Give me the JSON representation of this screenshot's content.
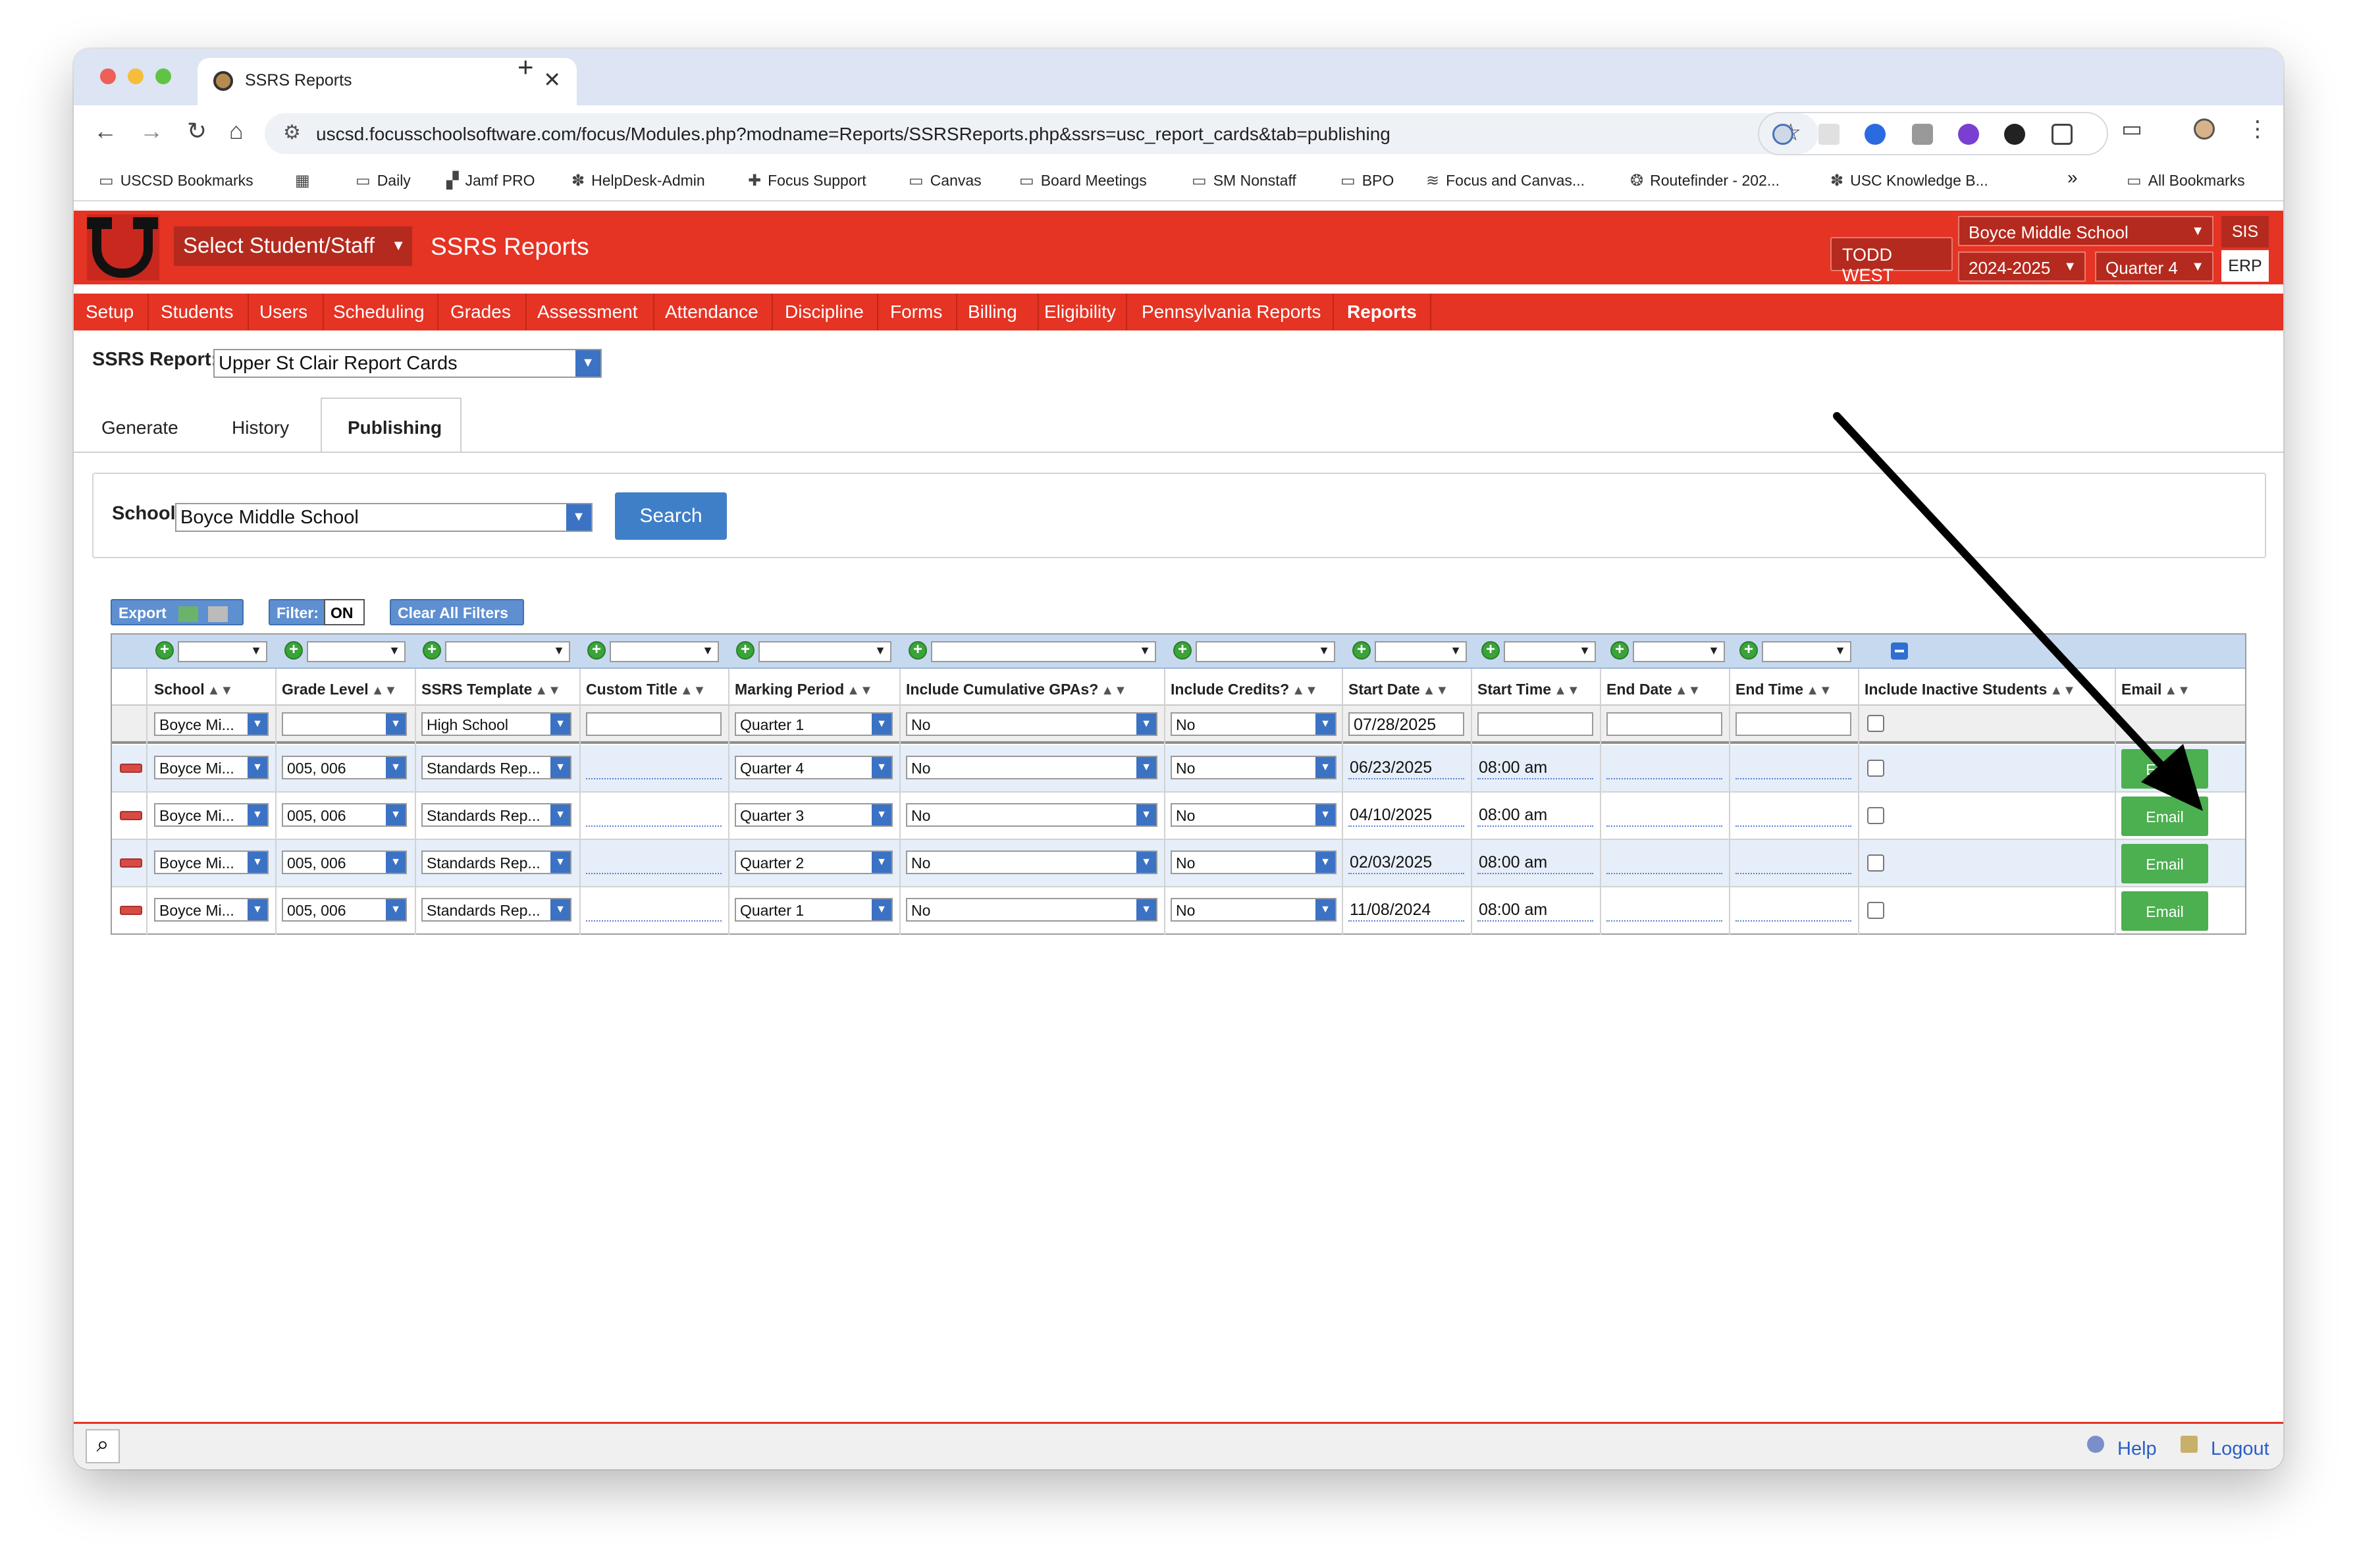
{
  "browser": {
    "tab_title": "SSRS Reports",
    "tab_close": "✕",
    "new_tab": "+",
    "url": "uscsd.focusschoolsoftware.com/focus/Modules.php?modname=Reports/SSRSReports.php&ssrs=usc_report_cards&tab=publishing",
    "bookmarks": [
      "USCSD Bookmarks",
      "Daily",
      "Jamf PRO",
      "HelpDesk-Admin",
      "Focus Support",
      "Canvas",
      "Board Meetings",
      "SM Nonstaff",
      "BPO",
      "Focus and Canvas...",
      "Routefinder - 202...",
      "USC Knowledge B..."
    ],
    "bookmarks_overflow": "»",
    "all_bookmarks": "All Bookmarks"
  },
  "header": {
    "select_student": "Select Student/Staff",
    "title": "SSRS Reports",
    "user": "TODD WEST",
    "school": "Boyce Middle School",
    "year": "2024-2025",
    "quarter": "Quarter 4",
    "sis": "SIS",
    "erp": "ERP"
  },
  "menu": [
    "Setup",
    "Students",
    "Users",
    "Scheduling",
    "Grades",
    "Assessment",
    "Attendance",
    "Discipline",
    "Forms",
    "Billing",
    "Eligibility",
    "Pennsylvania Reports",
    "Reports"
  ],
  "report": {
    "label": "SSRS Report:",
    "value": "Upper St Clair Report Cards"
  },
  "tabs": [
    "Generate",
    "History",
    "Publishing"
  ],
  "school_filter": {
    "label": "School:",
    "value": "Boyce Middle School",
    "search_button": "Search"
  },
  "list_toolbar": {
    "export": "Export",
    "filter": "Filter:",
    "filter_state": "ON",
    "clear_filters": "Clear All Filters"
  },
  "table": {
    "columns": [
      "School",
      "Grade Level",
      "SSRS Template",
      "Custom Title",
      "Marking Period",
      "Include Cumulative GPAs?",
      "Include Credits?",
      "Start Date",
      "Start Time",
      "End Date",
      "End Time",
      "Include Inactive Students",
      "Email"
    ],
    "sort_icon": "▲▼",
    "new_row": {
      "school": "Boyce Mi...",
      "grade": "",
      "template": "High School",
      "custom_title": "",
      "marking_period": "Quarter 1",
      "gpas": "No",
      "credits": "No",
      "start_date": "07/28/2025",
      "start_time": "",
      "end_date": "",
      "end_time": ""
    },
    "rows": [
      {
        "school": "Boyce Mi...",
        "grade": "005, 006",
        "template": "Standards Rep...",
        "custom_title": "",
        "marking_period": "Quarter 4",
        "gpas": "No",
        "credits": "No",
        "start_date": "06/23/2025",
        "start_time": "08:00 am",
        "end_date": "",
        "end_time": "",
        "email": "Email"
      },
      {
        "school": "Boyce Mi...",
        "grade": "005, 006",
        "template": "Standards Rep...",
        "custom_title": "",
        "marking_period": "Quarter 3",
        "gpas": "No",
        "credits": "No",
        "start_date": "04/10/2025",
        "start_time": "08:00 am",
        "end_date": "",
        "end_time": "",
        "email": "Email"
      },
      {
        "school": "Boyce Mi...",
        "grade": "005, 006",
        "template": "Standards Rep...",
        "custom_title": "",
        "marking_period": "Quarter 2",
        "gpas": "No",
        "credits": "No",
        "start_date": "02/03/2025",
        "start_time": "08:00 am",
        "end_date": "",
        "end_time": "",
        "email": "Email"
      },
      {
        "school": "Boyce Mi...",
        "grade": "005, 006",
        "template": "Standards Rep...",
        "custom_title": "",
        "marking_period": "Quarter 1",
        "gpas": "No",
        "credits": "No",
        "start_date": "11/08/2024",
        "start_time": "08:00 am",
        "end_date": "",
        "end_time": "",
        "email": "Email"
      }
    ]
  },
  "footer": {
    "help": "Help",
    "logout": "Logout"
  },
  "colors": {
    "brand_red": "#e53324",
    "accent_blue": "#3e7fc8",
    "email_green": "#4caf50"
  }
}
